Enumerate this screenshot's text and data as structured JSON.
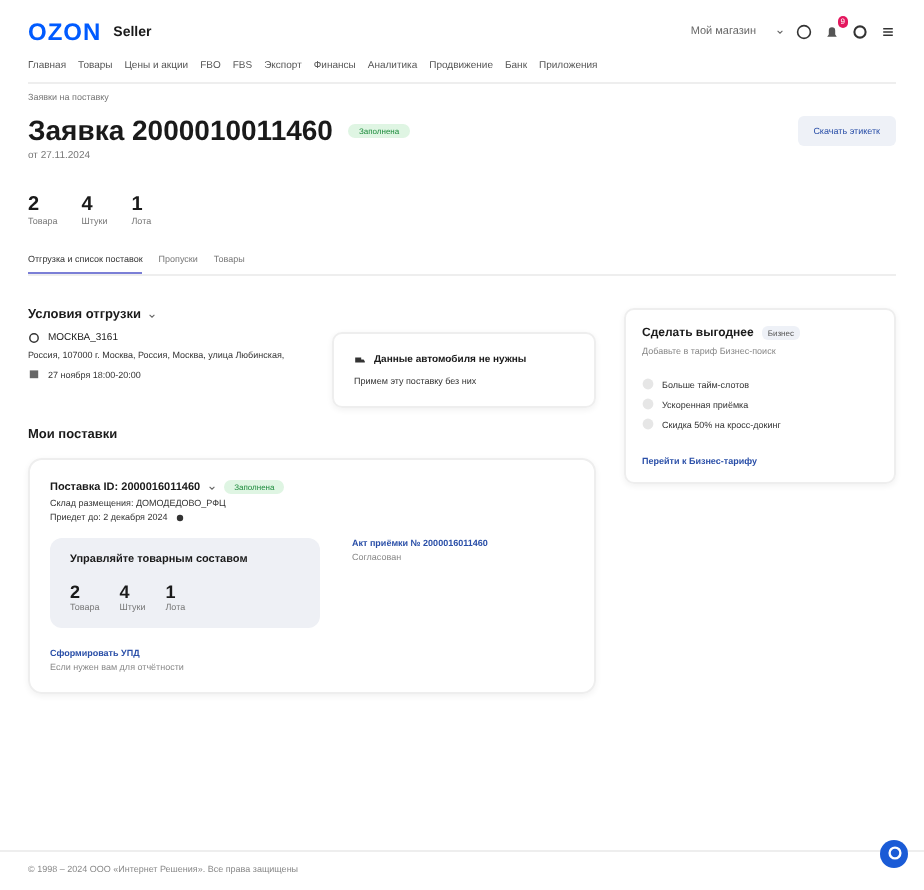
{
  "header": {
    "logo": "OZON",
    "logo_sub": "Seller",
    "account": "Мой магазин",
    "notification_count": "9"
  },
  "nav": [
    "Главная",
    "Товары",
    "Цены и акции",
    "FBO",
    "FBS",
    "Экспорт",
    "Финансы",
    "Аналитика",
    "Продвижение",
    "Банк",
    "Приложения"
  ],
  "breadcrumb": "Заявки на поставку",
  "title": "Заявка 2000010011460",
  "status": "Заполнена",
  "date": "от 27.11.2024",
  "download_button": "Скачать этикетк",
  "stats": [
    {
      "value": "2",
      "label": "Товара"
    },
    {
      "value": "4",
      "label": "Штуки"
    },
    {
      "value": "1",
      "label": "Лота"
    }
  ],
  "tabs": [
    {
      "label": "Отгрузка и список поставок",
      "selected": true
    },
    {
      "label": "Пропуски",
      "selected": false
    },
    {
      "label": "Товары",
      "selected": false
    }
  ],
  "shipping": {
    "heading": "Условия отгрузки",
    "warehouse": "МОСКВА_3161",
    "address": "Россия, 107000 г. Москва, Россия, Москва, улица Любинская,",
    "slot": "27 ноября 18:00-20:00"
  },
  "vehicle_card": {
    "title": "Данные автомобиля не нужны",
    "text": "Примем эту поставку без них"
  },
  "promo": {
    "title": "Сделать выгоднее",
    "badge": "Бизнес",
    "subtitle": "Добавьте в тариф Бизнес-поиск",
    "options": [
      "Больше тайм-слотов",
      "Ускоренная приёмка",
      "Скидка 50% на кросс-докинг"
    ],
    "link": "Перейти к Бизнес-тарифу"
  },
  "supplies_heading": "Мои поставки",
  "supply": {
    "title": "Поставка ID: 2000016011460",
    "status": "Заполнена",
    "warehouse": "Склад размещения: ДОМОДЕДОВО_РФЦ",
    "arrival": "Приедет до: 2 декабря 2024",
    "manage_title": "Управляйте товарным составом",
    "stats": [
      {
        "value": "2",
        "label": "Товара"
      },
      {
        "value": "4",
        "label": "Штуки"
      },
      {
        "value": "1",
        "label": "Лота"
      }
    ],
    "act_link": "Акт приёмки № 2000016011460",
    "act_status": "Согласован",
    "upd_link": "Сформировать УПД",
    "upd_text": "Если нужен вам для отчётности"
  },
  "footer": "© 1998 – 2024 ООО «Интернет Решения». Все права защищены"
}
